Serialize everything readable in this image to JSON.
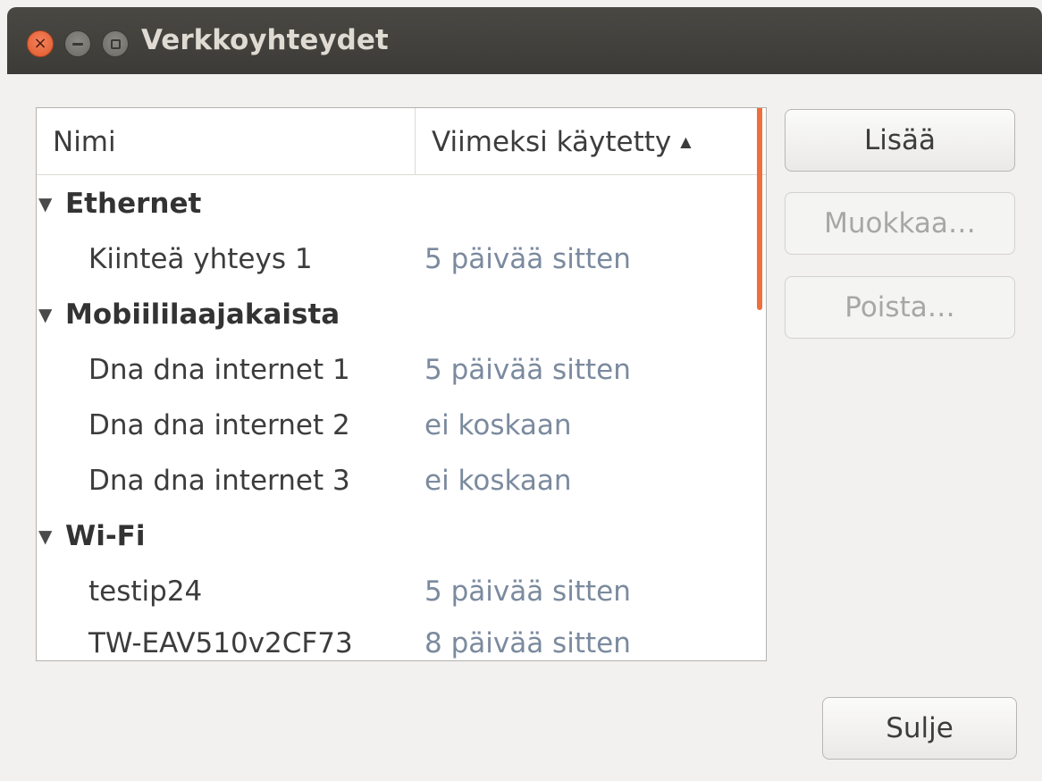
{
  "window": {
    "title": "Verkkoyhteydet",
    "controls": {
      "close": "×",
      "minimize": "minimize",
      "maximize": "maximize"
    }
  },
  "list": {
    "columns": {
      "name": "Nimi",
      "last_used": "Viimeksi käytetty",
      "sort_indicator": "▲"
    },
    "groups": [
      {
        "name": "Ethernet",
        "expander": "▼",
        "items": [
          {
            "name": "Kiinteä yhteys 1",
            "last_used": "5 päivää sitten"
          }
        ]
      },
      {
        "name": "Mobiililaajakaista",
        "expander": "▼",
        "items": [
          {
            "name": "Dna dna internet 1",
            "last_used": "5 päivää sitten"
          },
          {
            "name": "Dna dna internet 2",
            "last_used": "ei koskaan"
          },
          {
            "name": "Dna dna internet 3",
            "last_used": "ei koskaan"
          }
        ]
      },
      {
        "name": "Wi-Fi",
        "expander": "▼",
        "items": [
          {
            "name": "testip24",
            "last_used": "5 päivää sitten"
          },
          {
            "name": "TW-EAV510v2CF73",
            "last_used": "8 päivää sitten"
          }
        ]
      }
    ]
  },
  "buttons": {
    "add": "Lisää",
    "edit": "Muokkaa…",
    "delete": "Poista…",
    "close": "Sulje"
  },
  "colors": {
    "accent": "#ef6f3c",
    "titlebar": "#3c3b37",
    "time_text": "#7b8a9e"
  }
}
